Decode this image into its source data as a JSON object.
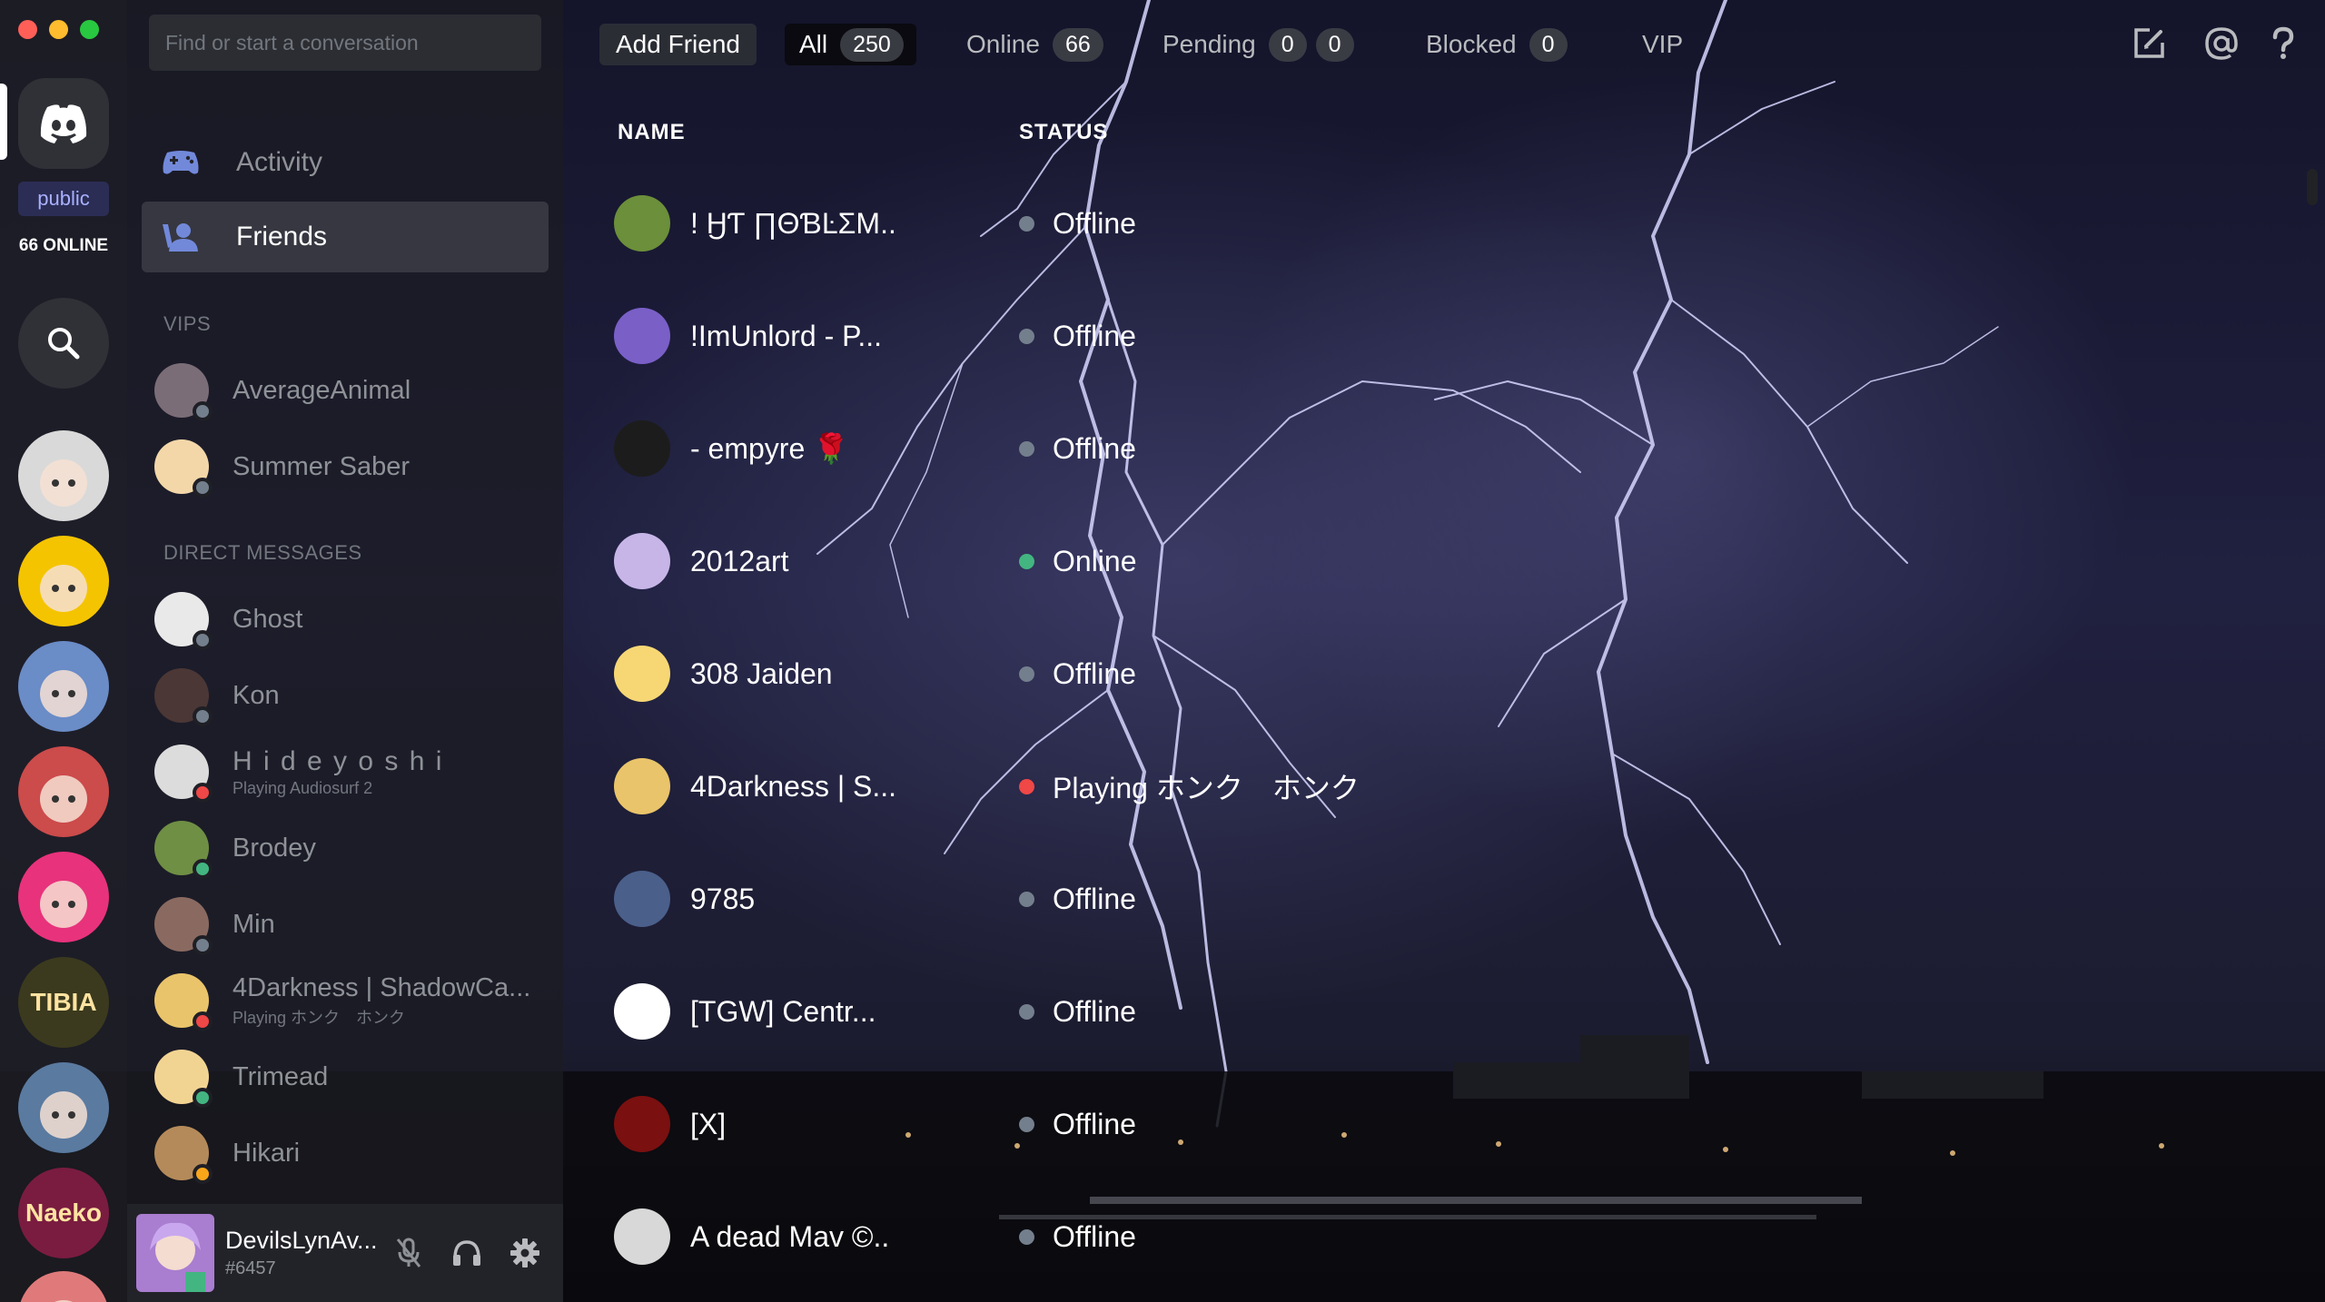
{
  "window": {
    "title": "Discord"
  },
  "colors": {
    "online": "#43b581",
    "offline": "#747f8d",
    "dnd": "#f04747",
    "idle": "#faa61a",
    "blurple": "#7289da",
    "accent_pink": "#ff3d73"
  },
  "rail": {
    "public_label": "public",
    "online_label": "66 ONLINE",
    "servers": [
      {
        "name": "server-white-hair-girl",
        "color": "#d9d9d9"
      },
      {
        "name": "server-green-hat-girl",
        "color": "#f5c400"
      },
      {
        "name": "server-anime-group",
        "color": "#6a8cc7"
      },
      {
        "name": "server-red-face",
        "color": "#cc4b4b"
      },
      {
        "name": "server-pink-cat",
        "color": "#e8327c"
      },
      {
        "name": "server-tibia",
        "color": "#3b3a1e",
        "text": "TIBIA"
      },
      {
        "name": "server-portal",
        "color": "#5a7aa0"
      },
      {
        "name": "server-naeko",
        "color": "#7a1c40",
        "text": "Naeko"
      },
      {
        "name": "server-partial",
        "color": "#e07a7a"
      }
    ]
  },
  "sidebar": {
    "search_placeholder": "Find or start a conversation",
    "nav": [
      {
        "label": "Activity",
        "icon": "gamepad-icon"
      },
      {
        "label": "Friends",
        "icon": "friends-icon"
      }
    ],
    "vips_header": "VIPS",
    "vips": [
      {
        "name": "AverageAnimal",
        "status": "offline",
        "avatar": "#7b6d77"
      },
      {
        "name": "Summer Saber",
        "status": "offline",
        "avatar": "#f3d7a8"
      }
    ],
    "dm_header": "DIRECT MESSAGES",
    "dms": [
      {
        "name": "Ghost",
        "status": "offline",
        "avatar": "#e9e9e9"
      },
      {
        "name": "Kon",
        "status": "offline",
        "avatar": "#4b3735"
      },
      {
        "name": "H i d e y o s h i",
        "sub": "Playing Audiosurf 2",
        "status": "dnd",
        "avatar": "#dcdcdc"
      },
      {
        "name": "Brodey",
        "status": "online",
        "avatar": "#6f8f44"
      },
      {
        "name": "Min",
        "status": "offline",
        "avatar": "#8a6a60"
      },
      {
        "name": "4Darkness | ShadowCa...",
        "sub": "Playing ホンク　ホンク",
        "status": "dnd",
        "avatar": "#e9c46a"
      },
      {
        "name": "Trimead",
        "status": "online",
        "avatar": "#f2d492"
      },
      {
        "name": "Hikari",
        "status": "idle",
        "avatar": "#b58a5a"
      }
    ]
  },
  "user": {
    "name": "DevilsLynAv...",
    "tag": "#6457",
    "avatar": "#a97dd0"
  },
  "topbar": {
    "add_friend": "Add Friend",
    "tabs": [
      {
        "label": "All",
        "count": "250"
      },
      {
        "label": "Online",
        "count": "66"
      },
      {
        "label": "Pending",
        "count": "0",
        "count2": "0"
      },
      {
        "label": "Blocked",
        "count": "0"
      },
      {
        "label": "VIP"
      }
    ]
  },
  "table": {
    "col_name": "NAME",
    "col_status": "STATUS",
    "friends": [
      {
        "name": "! ӇƬ ∏ΘƁĿΣΜ..",
        "status": "Offline",
        "state": "offline",
        "avatar": "#6b8f3a"
      },
      {
        "name": "!ImUnlord - P...",
        "status": "Offline",
        "state": "offline",
        "avatar": "#7a5fc7"
      },
      {
        "name": "- empyre 🌹",
        "status": "Offline",
        "state": "offline",
        "avatar": "#1c1c1c"
      },
      {
        "name": "2012art",
        "status": "Online",
        "state": "online",
        "avatar": "#c7b5e8"
      },
      {
        "name": "308 Jaiden",
        "status": "Offline",
        "state": "offline",
        "avatar": "#f7d774"
      },
      {
        "name": "4Darkness | S...",
        "status": "Playing ホンク　ホンク",
        "state": "dnd",
        "avatar": "#e9c46a"
      },
      {
        "name": "9785",
        "status": "Offline",
        "state": "offline",
        "avatar": "#4a5f8a"
      },
      {
        "name": "[TGW] Centr...",
        "status": "Offline",
        "state": "offline",
        "avatar": "#ffffff"
      },
      {
        "name": "[X]",
        "status": "Offline",
        "state": "offline",
        "avatar": "#7a1010"
      },
      {
        "name": "A dead Mav ©..",
        "status": "Offline",
        "state": "offline",
        "avatar": "#d8d8d8"
      }
    ]
  }
}
